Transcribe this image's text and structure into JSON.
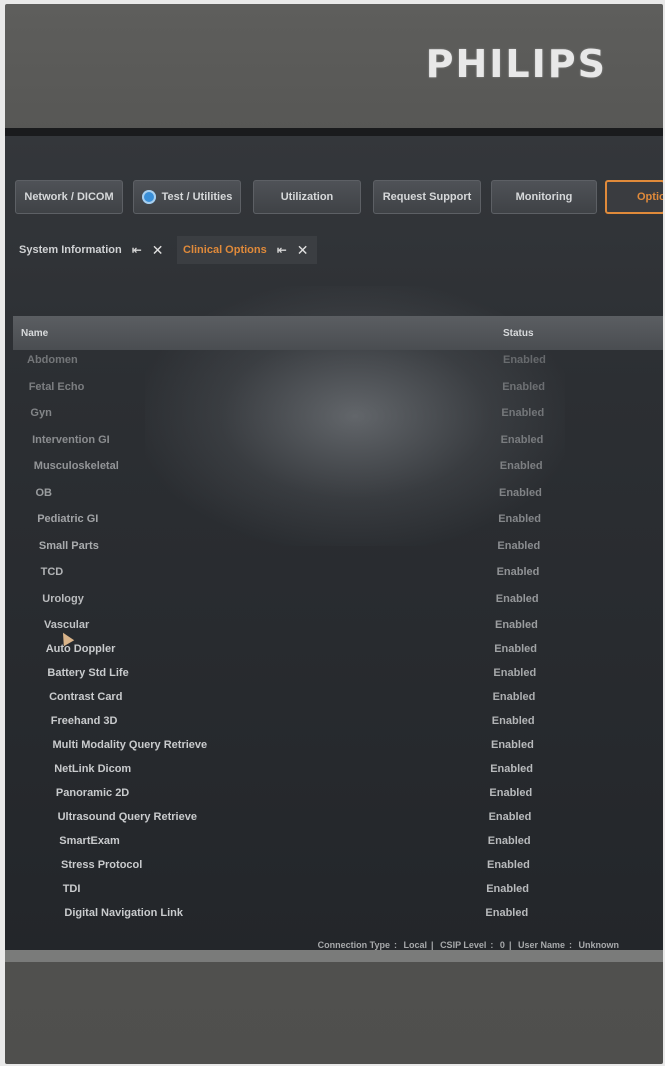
{
  "brand": "PHILIPS",
  "top_tabs": [
    {
      "label": "Network / DICOM"
    },
    {
      "label": "Test / Utilities",
      "icon": "gear-icon"
    },
    {
      "label": "Utilization"
    },
    {
      "label": "Request Support"
    },
    {
      "label": "Monitoring"
    },
    {
      "label": "Options",
      "active": true
    }
  ],
  "sub_tabs": [
    {
      "label": "System Information"
    },
    {
      "label": "Clinical Options",
      "active": true
    }
  ],
  "table": {
    "headers": {
      "name": "Name",
      "status": "Status"
    },
    "rows": [
      {
        "name": "Abdomen",
        "status": "Enabled"
      },
      {
        "name": "Fetal Echo",
        "status": "Enabled"
      },
      {
        "name": "Gyn",
        "status": "Enabled"
      },
      {
        "name": "Intervention GI",
        "status": "Enabled"
      },
      {
        "name": "Musculoskeletal",
        "status": "Enabled"
      },
      {
        "name": "OB",
        "status": "Enabled"
      },
      {
        "name": "Pediatric GI",
        "status": "Enabled"
      },
      {
        "name": "Small Parts",
        "status": "Enabled"
      },
      {
        "name": "TCD",
        "status": "Enabled"
      },
      {
        "name": "Urology",
        "status": "Enabled"
      },
      {
        "name": "Vascular",
        "status": "Enabled"
      },
      {
        "name": "Auto Doppler",
        "status": "Enabled"
      },
      {
        "name": "Battery Std Life",
        "status": "Enabled"
      },
      {
        "name": "Contrast Card",
        "status": "Enabled"
      },
      {
        "name": "Freehand 3D",
        "status": "Enabled"
      },
      {
        "name": "Multi Modality Query Retrieve",
        "status": "Enabled"
      },
      {
        "name": "NetLink Dicom",
        "status": "Enabled"
      },
      {
        "name": "Panoramic 2D",
        "status": "Enabled"
      },
      {
        "name": "Ultrasound Query Retrieve",
        "status": "Enabled"
      },
      {
        "name": "SmartExam",
        "status": "Enabled"
      },
      {
        "name": "Stress Protocol",
        "status": "Enabled"
      },
      {
        "name": "TDI",
        "status": "Enabled"
      },
      {
        "name": "Digital Navigation Link",
        "status": "Enabled"
      }
    ]
  },
  "status_bar": {
    "connection_label": "Connection Type",
    "connection_value": "Local",
    "csip_label": "CSIP Level",
    "csip_value": "0",
    "user_label": "User Name",
    "user_value": "Unknown"
  }
}
